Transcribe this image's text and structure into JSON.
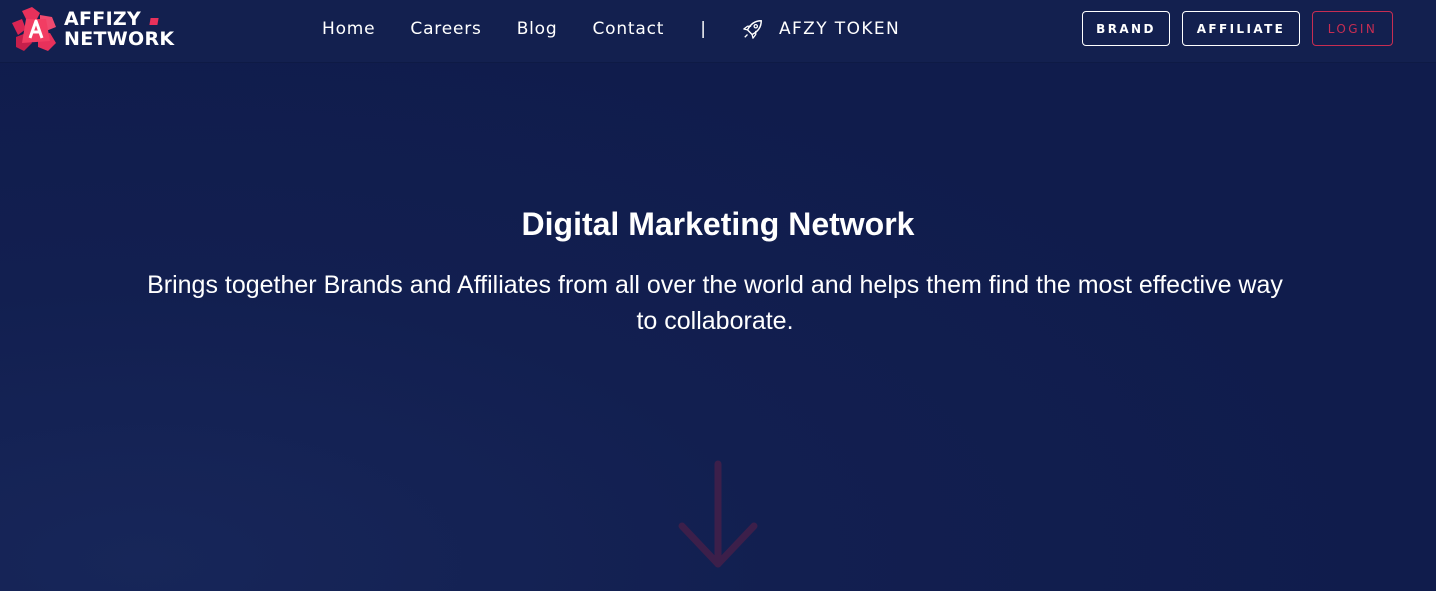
{
  "logo": {
    "line1": "AFFIZY",
    "line2": "NETWORK",
    "accent_color": "#e8315b"
  },
  "nav": {
    "items": [
      {
        "label": "Home"
      },
      {
        "label": "Careers"
      },
      {
        "label": "Blog"
      },
      {
        "label": "Contact"
      }
    ],
    "separator": "|",
    "token": {
      "label": "AFZY TOKEN",
      "icon": "rocket-icon"
    }
  },
  "buttons": {
    "brand": "BRAND",
    "affiliate": "AFFILIATE",
    "login": "LOGIN"
  },
  "hero": {
    "title": "Digital Marketing Network",
    "subtitle": "Brings together Brands and Affiliates from all over the world and helps them find the most effective way to collaborate.",
    "scroll_icon": "arrow-down-icon"
  },
  "colors": {
    "background": "#101d4d",
    "header": "#13204f",
    "login_accent": "#c72d52",
    "arrow": "#3c1f4a"
  }
}
